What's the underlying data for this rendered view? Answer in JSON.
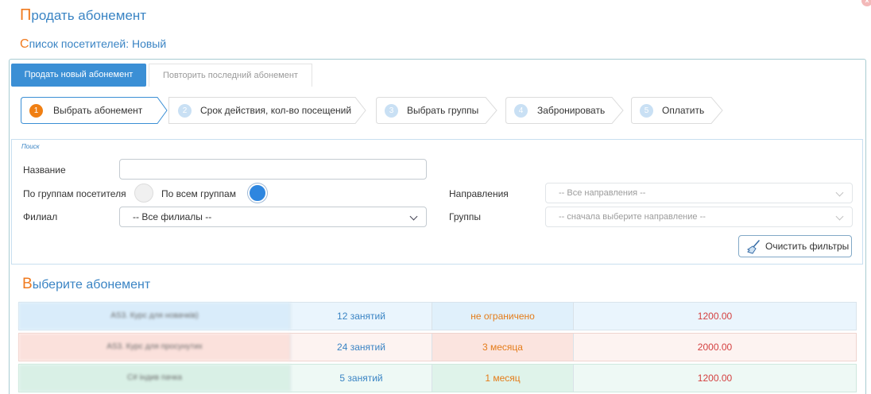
{
  "page": {
    "title_first": "П",
    "title_rest": "родать абонемент",
    "subtitle_first": "С",
    "subtitle_rest": "писок посетителей: Новый",
    "close_symbol": "×"
  },
  "tabs": [
    {
      "label": "Продать новый абонемент",
      "active": true
    },
    {
      "label": "Повторить последний абонемент",
      "active": false
    }
  ],
  "steps": [
    {
      "num": "1",
      "label": "Выбрать абонемент",
      "active": true
    },
    {
      "num": "2",
      "label": "Срок действия, кол-во посещений",
      "active": false
    },
    {
      "num": "3",
      "label": "Выбрать группы",
      "active": false
    },
    {
      "num": "4",
      "label": "Забронировать",
      "active": false
    },
    {
      "num": "5",
      "label": "Оплатить",
      "active": false
    }
  ],
  "search": {
    "legend": "Поиск",
    "name_label": "Название",
    "name_value": "",
    "by_visitor_groups_label": "По группам посетителя",
    "all_groups_label": "По всем группам",
    "branch_label": "Филиал",
    "branch_value": "-- Все филиалы --",
    "directions_label": "Направления",
    "directions_value": "-- Все направления --",
    "groups_label": "Группы",
    "groups_value": "-- сначала выберите направление --",
    "clear_button": "Очистить фильтры"
  },
  "section": {
    "first": "В",
    "rest": "ыберите абонемент"
  },
  "subscriptions": [
    {
      "name": "AS3. Курс для новачків)",
      "count": "12 занятий",
      "term": "не ограничено",
      "price": "1200.00"
    },
    {
      "name": "AS3. Курс для просунутих",
      "count": "24 занятий",
      "term": "3 месяца",
      "price": "2000.00"
    },
    {
      "name": "C# індив пачка",
      "count": "5 занятий",
      "term": "1 месяц",
      "price": "1200.00"
    }
  ],
  "colors": {
    "accent": "#3b8fd5",
    "orange": "#f07a1e",
    "price": "#d44040"
  }
}
